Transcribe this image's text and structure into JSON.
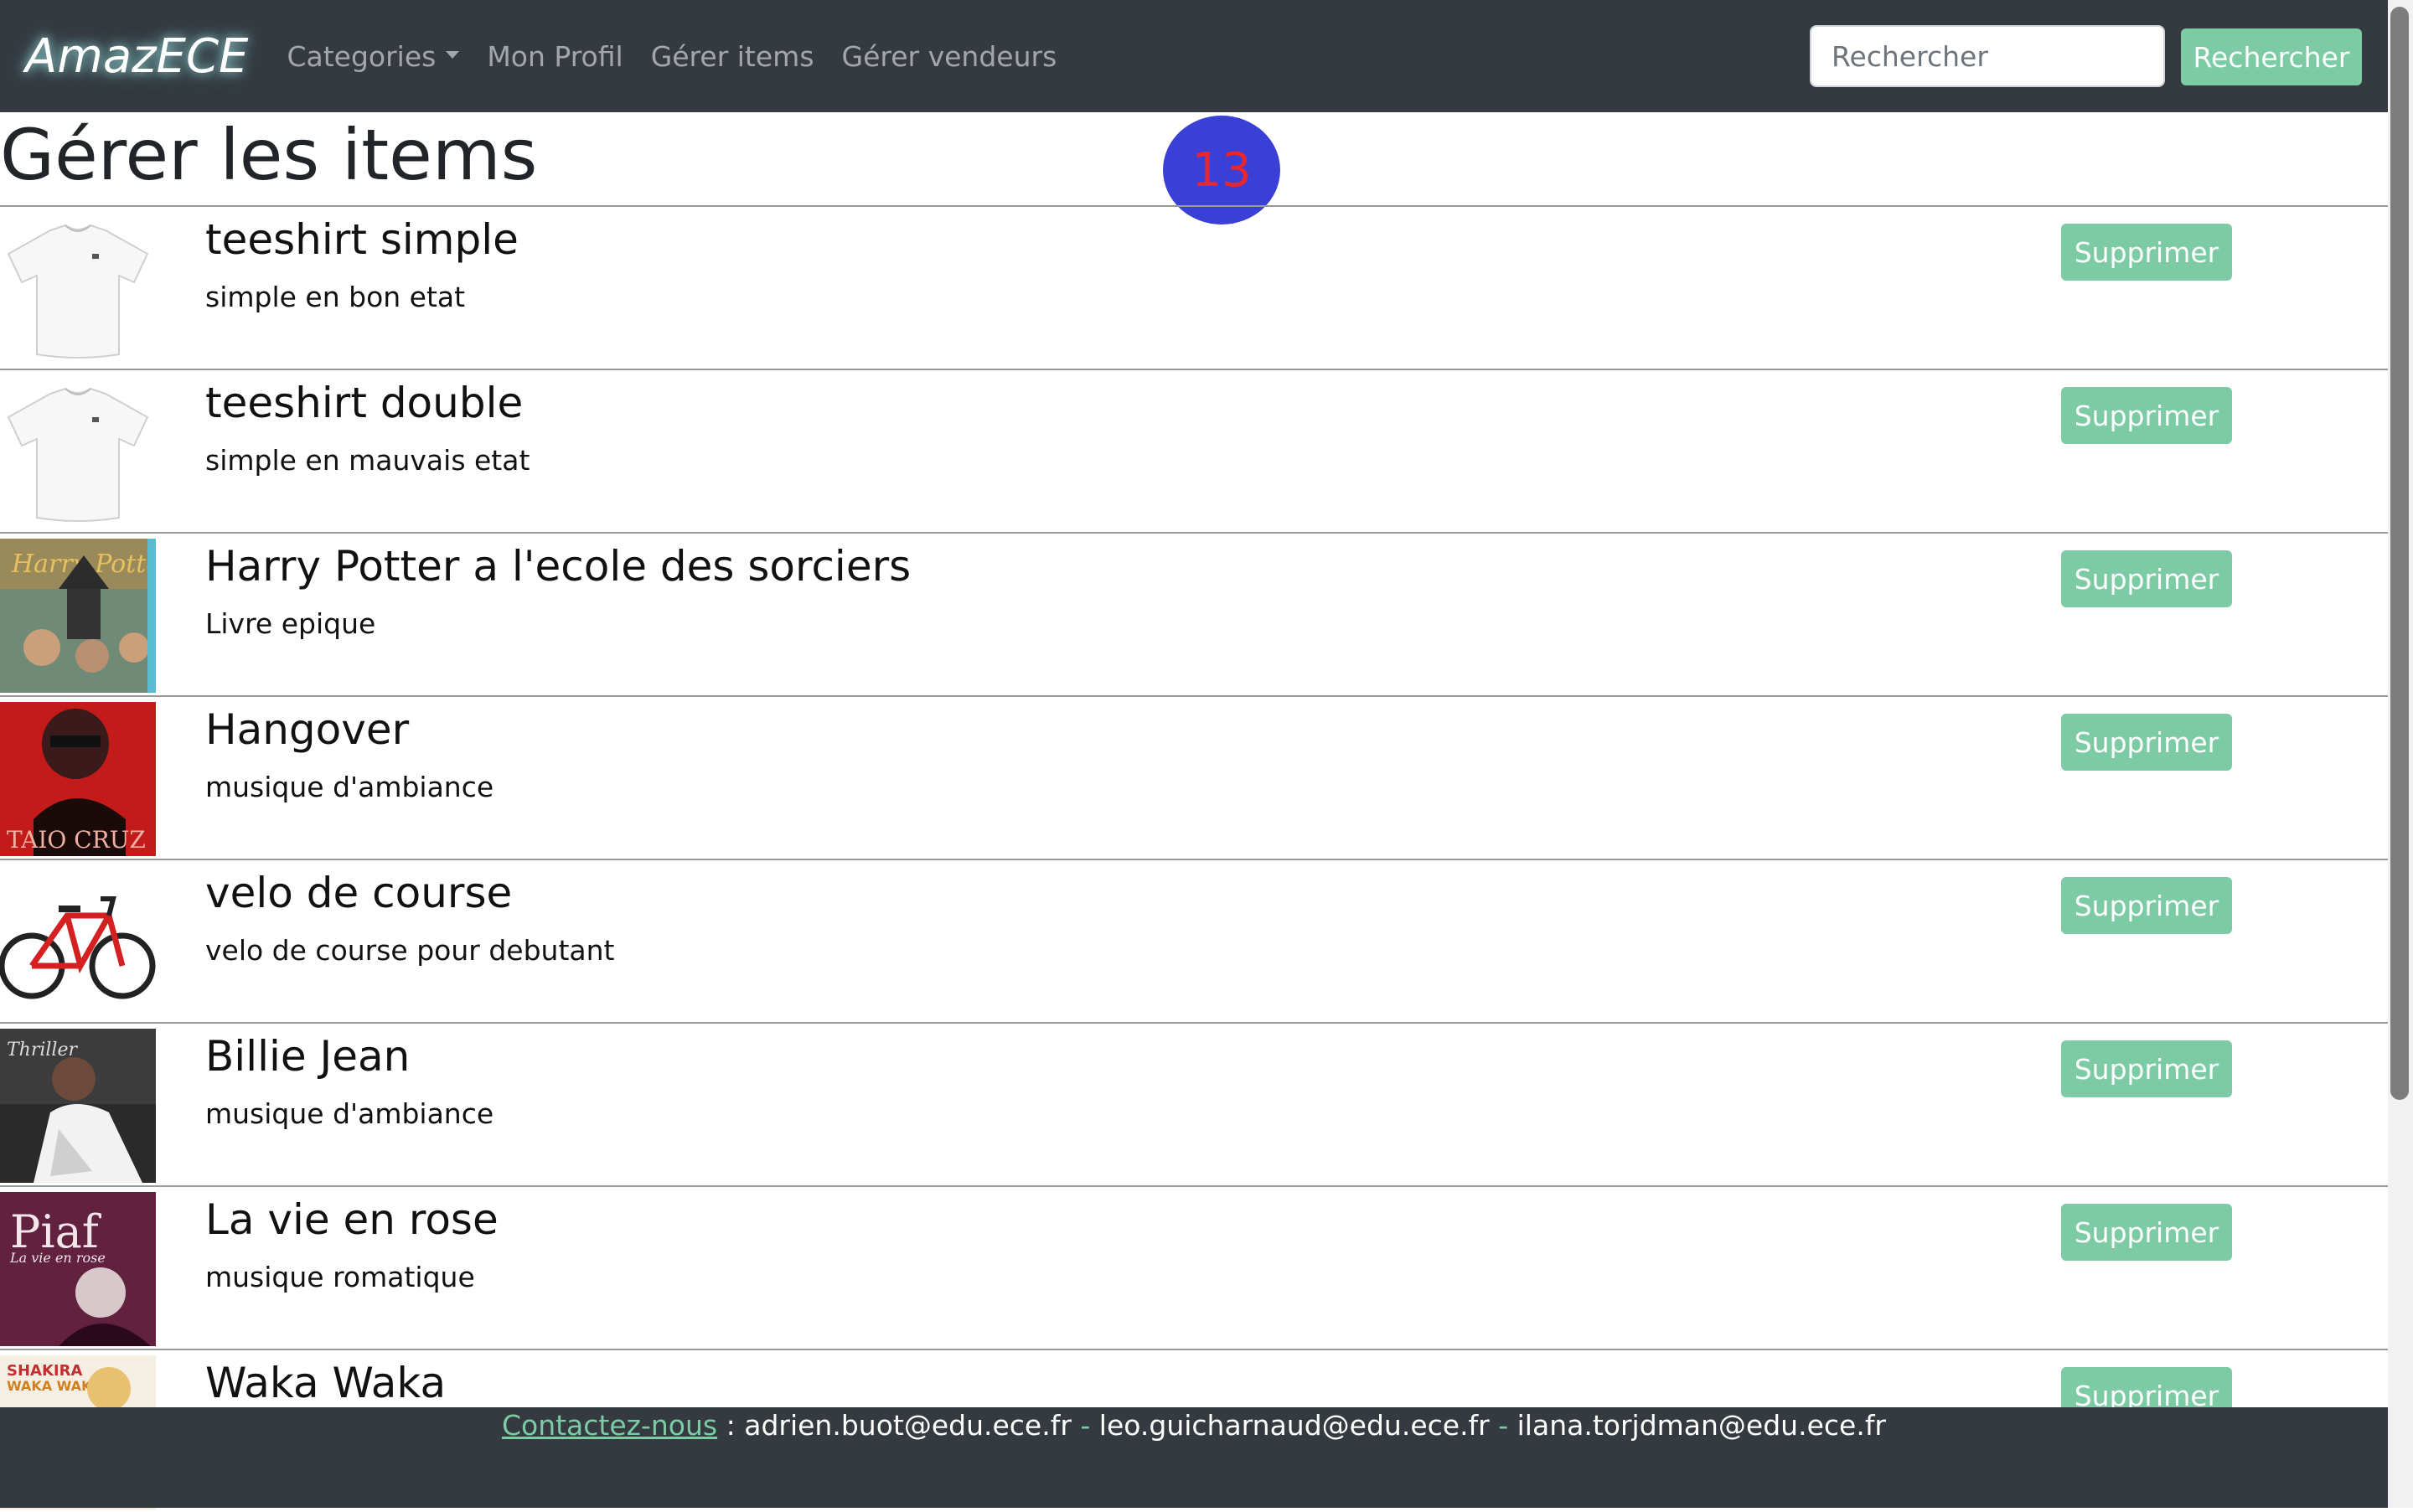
{
  "navbar": {
    "brand": "AmazECE",
    "links": [
      "Categories",
      "Mon Profil",
      "Gérer items",
      "Gérer vendeurs"
    ],
    "search_placeholder": "Rechercher",
    "search_button": "Rechercher"
  },
  "page": {
    "title": "Gérer les items",
    "badge": "13"
  },
  "items": [
    {
      "name": "teeshirt simple",
      "desc": "simple en bon etat",
      "image": "white-tshirt",
      "action": "Supprimer"
    },
    {
      "name": "teeshirt double",
      "desc": "simple en mauvais etat",
      "image": "white-tshirt",
      "action": "Supprimer"
    },
    {
      "name": "Harry Potter a l'ecole des sorciers",
      "desc": "Livre epique",
      "image": "harry-potter-cover",
      "action": "Supprimer"
    },
    {
      "name": "Hangover",
      "desc": "musique d'ambiance",
      "image": "taio-cruz-hangover-cover",
      "action": "Supprimer"
    },
    {
      "name": "velo de course",
      "desc": "velo de course pour debutant",
      "image": "red-bicycle",
      "action": "Supprimer"
    },
    {
      "name": "Billie Jean",
      "desc": "musique d'ambiance",
      "image": "michael-jackson-cover",
      "action": "Supprimer"
    },
    {
      "name": "La vie en rose",
      "desc": "musique romatique",
      "image": "edith-piaf-cover",
      "action": "Supprimer"
    },
    {
      "name": "Waka Waka",
      "desc": "",
      "image": "shakira-waka-waka-cover",
      "action": "Supprimer"
    }
  ],
  "footer": {
    "contact_link": "Contactez-nous",
    "colon": " : ",
    "email1": "adrien.buot@edu.ece.fr",
    "sep": " - ",
    "email2": "leo.guicharnaud@edu.ece.fr",
    "email3": "ilana.torjdman@edu.ece.fr"
  },
  "colors": {
    "navbar": "#343a40",
    "accent": "#7ccba4",
    "badge_bg": "#3a3fd6",
    "badge_text": "#e8262e"
  }
}
